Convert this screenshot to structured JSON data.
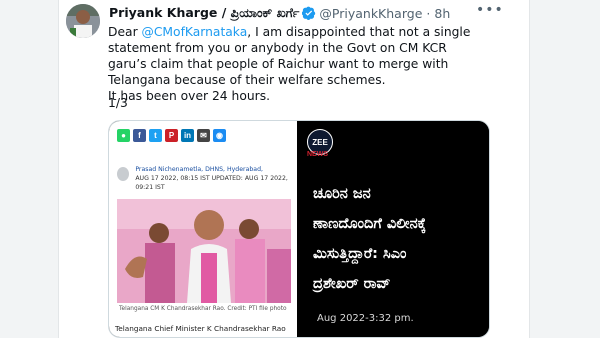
{
  "tweet": {
    "name": "Priyank Kharge / ಪ್ರಿಯಾಂಕ್ ಖರ್ಗೆ",
    "handle": "@PriyankKharge",
    "separator": "·",
    "time": "8h",
    "more_icon": "ellipsis-icon",
    "verified_icon": "verified-badge-icon",
    "text_prefix": "Dear ",
    "mention": "@CMofKarnataka",
    "text_rest": ", I am disappointed that not a single statement from you or anybody in the Govt on CM KCR garu’s claim that people of Raichur want to merge with Telangana because of their welfare schemes.",
    "text_line2": "It has been over 24 hours.",
    "thread_count": "1/3"
  },
  "media": {
    "left": {
      "share_icons": [
        "whatsapp-icon",
        "facebook-icon",
        "twitter-icon",
        "pinterest-icon",
        "linkedin-icon",
        "email-icon",
        "messenger-icon"
      ],
      "author": "Prasad Nichenametla, DHNS, Hyderabad,",
      "dates": "AUG 17 2022, 08:15 IST UPDATED: AUG 17 2022, 09:21 IST",
      "photo_caption": "Telangana CM K Chandrasekhar Rao. Credit: PTI file photo",
      "headline_caption": "Telangana Chief Minister K Chandrasekhar Rao"
    },
    "right": {
      "logo_text": "ZEE",
      "brand_text": "NEWS",
      "headline_lines": [
        "ಚೂರಿನ ಜನ",
        "ಣಾಣದೊಂದಿಗೆ ವಿಲೀನಕ್ಕೆ",
        "ಮಿಸುತ್ತಿದ್ದಾರೆ: ಸಿಎಂ",
        "ದ್ರಶೇಖರ್ ರಾವ್"
      ],
      "date": "Aug 2022-3:32 pm."
    }
  },
  "colors": {
    "link": "#1d9bf0",
    "secondary_text": "#536471",
    "zee_red": "#d0202e"
  }
}
